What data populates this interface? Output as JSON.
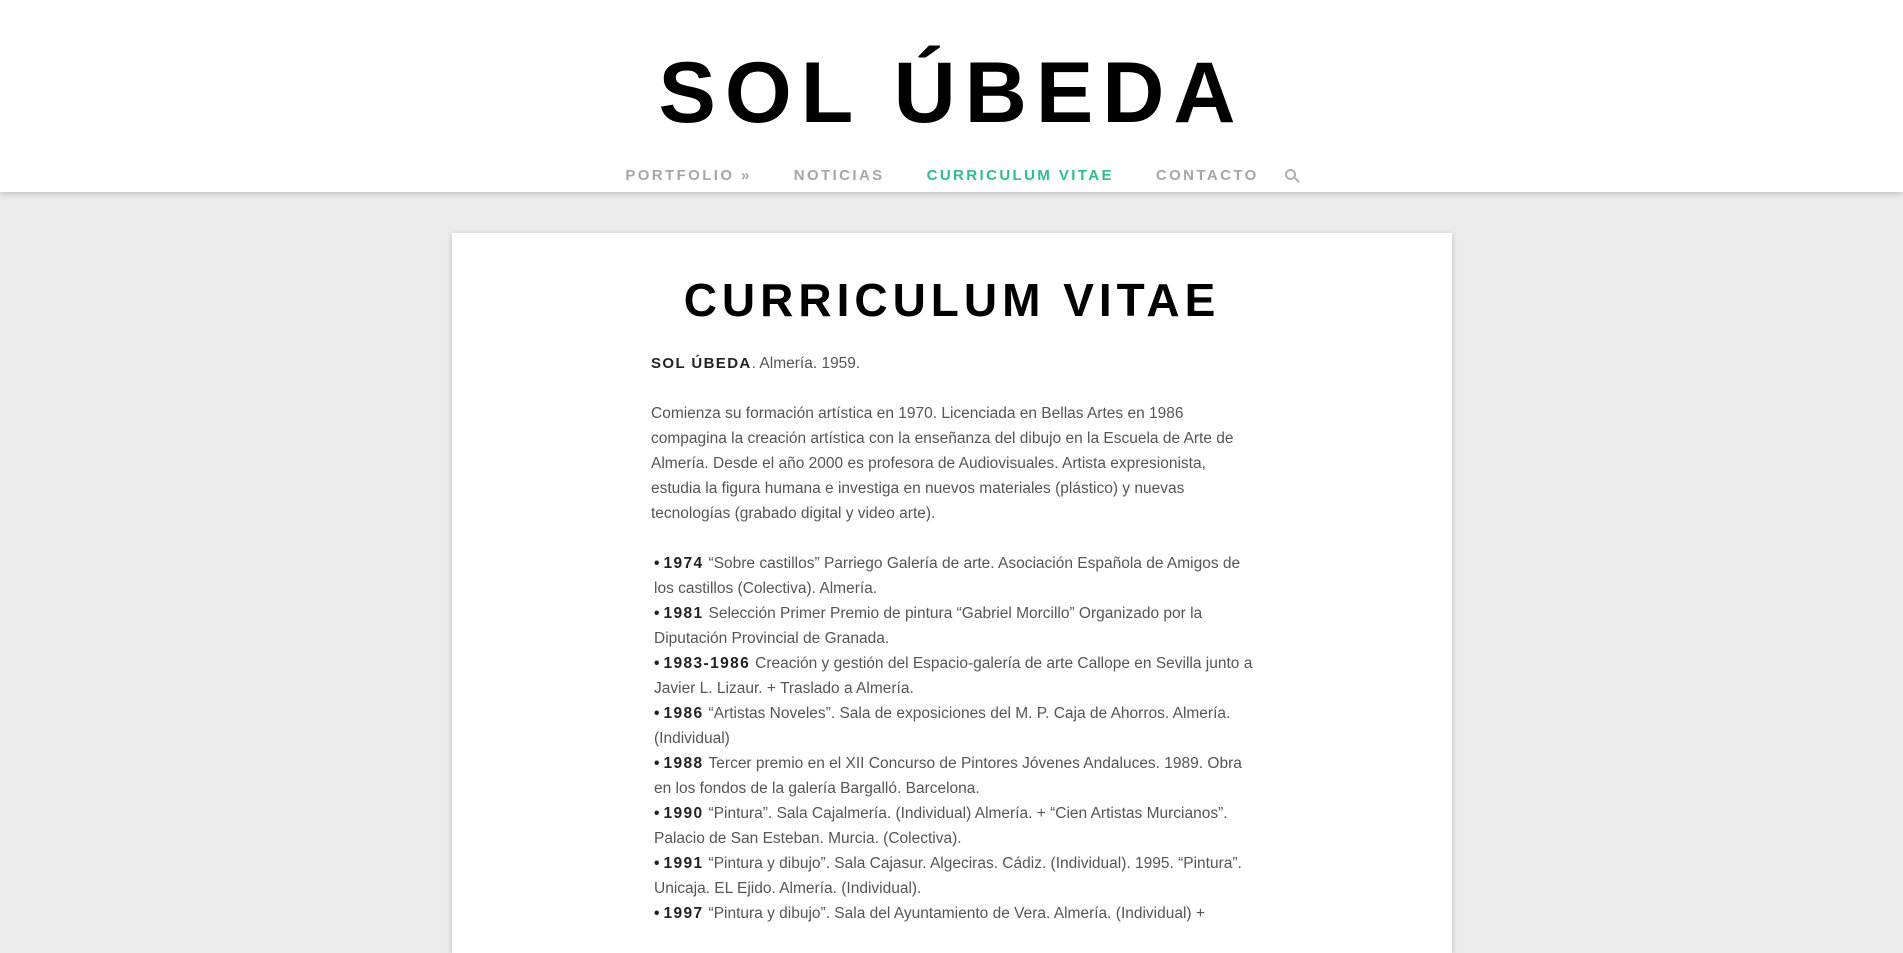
{
  "header": {
    "site_title": "SOL ÚBEDA",
    "nav": {
      "portfolio": "PORTFOLIO »",
      "noticias": "NOTICIAS",
      "curriculum": "CURRICULUM VITAE",
      "contacto": "CONTACTO"
    },
    "search_icon": "search-icon",
    "accent_color": "#2ebd8c"
  },
  "page": {
    "title": "CURRICULUM VITAE",
    "intro_name": "SOL ÚBEDA",
    "intro_suffix": ".  Almería. 1959.",
    "intro_text": "Comienza su formación artística en 1970. Licenciada en Bellas Artes en 1986 compagina  la creación artística con  la enseñanza del dibujo en la Escuela de Arte de Almería. Desde el año 2000 es profesora de Audiovisuales. Artista expresionista, estudia la figura humana e investiga en nuevos materiales  (plástico) y nuevas tecnologías (grabado digital y video arte).",
    "items": [
      {
        "year": "1974",
        "text": "“Sobre castillos” Parriego Galería de arte. Asociación Española de Amigos de los castillos (Colectiva). Almería."
      },
      {
        "year": "1981",
        "text": "Selección Primer Premio de pintura “Gabriel Morcillo” Organizado por la Diputación Provincial de Granada."
      },
      {
        "year": "1983-1986",
        "text": "Creación y gestión del Espacio-galería de arte Callope en Sevilla junto a Javier L. Lizaur. + Traslado a Almería."
      },
      {
        "year": "1986",
        "text": "“Artistas Noveles”. Sala de exposiciones del M. P. Caja de Ahorros. Almería. (Individual)"
      },
      {
        "year": "1988",
        "text": "Tercer premio en el XII Concurso de Pintores Jóvenes Andaluces. 1989. Obra en los fondos de la galería Bargalló. Barcelona."
      },
      {
        "year": "1990",
        "text": "“Pintura”. Sala Cajalmería. (Individual) Almería. + “Cien Artistas Murcianos”. Palacio de San Esteban. Murcia. (Colectiva)."
      },
      {
        "year": "1991",
        "text": "“Pintura y dibujo”. Sala Cajasur. Algeciras. Cádiz. (Individual). 1995. “Pintura”. Unicaja. EL Ejido. Almería. (Individual)."
      },
      {
        "year": "1997",
        "text": "“Pintura y dibujo”. Sala del Ayuntamiento de Vera. Almería. (Individual) +"
      }
    ]
  }
}
